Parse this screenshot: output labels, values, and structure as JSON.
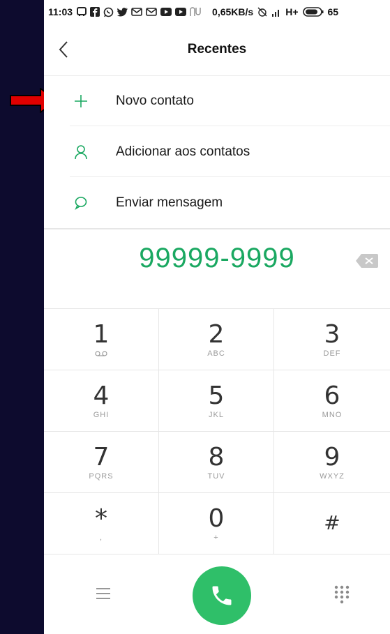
{
  "status_bar": {
    "time": "11:03",
    "network_speed": "0,65KB/s",
    "network_type": "H+",
    "battery": "65"
  },
  "header": {
    "title": "Recentes",
    "back_icon": "chevron-left-icon"
  },
  "menu": [
    {
      "label": "Novo contato",
      "icon": "plus-icon"
    },
    {
      "label": "Adicionar aos contatos",
      "icon": "person-icon"
    },
    {
      "label": "Enviar mensagem",
      "icon": "chat-bubble-icon"
    }
  ],
  "dialer": {
    "number": "99999-9999",
    "backspace_icon": "backspace-icon"
  },
  "keypad": [
    {
      "digit": "1",
      "letters": ""
    },
    {
      "digit": "2",
      "letters": "ABC"
    },
    {
      "digit": "3",
      "letters": "DEF"
    },
    {
      "digit": "4",
      "letters": "GHI"
    },
    {
      "digit": "5",
      "letters": "JKL"
    },
    {
      "digit": "6",
      "letters": "MNO"
    },
    {
      "digit": "7",
      "letters": "PQRS"
    },
    {
      "digit": "8",
      "letters": "TUV"
    },
    {
      "digit": "9",
      "letters": "WXYZ"
    },
    {
      "digit": "*",
      "letters": ","
    },
    {
      "digit": "0",
      "letters": "+"
    },
    {
      "digit": "#",
      "letters": ""
    }
  ],
  "colors": {
    "accent_green": "#1aa861",
    "call_button": "#2fbf69",
    "annotation_arrow": "#e00000",
    "outer_background": "#0d0b2e"
  }
}
